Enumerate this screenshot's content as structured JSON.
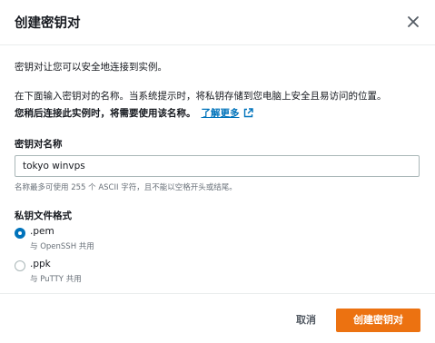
{
  "header": {
    "title": "创建密钥对",
    "close_icon": "close-icon"
  },
  "body": {
    "intro": "密钥对让您可以安全地连接到实例。",
    "instruction": "在下面输入密钥对的名称。当系统提示时，将私钥存储到您电脑上安全且易访问的位置。",
    "instruction_bold": "您稍后连接此实例时，将需要使用该名称。",
    "learn_more": "了解更多",
    "external_icon": "external-link-icon"
  },
  "name_field": {
    "label": "密钥对名称",
    "value": "tokyo winvps",
    "hint": "名称最多可使用 255 个 ASCII 字符，且不能以空格开头或结尾。"
  },
  "format": {
    "label": "私钥文件格式",
    "options": [
      {
        "label": ".pem",
        "desc": "与 OpenSSH 共用",
        "selected": true
      },
      {
        "label": ".ppk",
        "desc": "与 PuTTY 共用",
        "selected": false
      }
    ]
  },
  "footer": {
    "cancel_label": "取消",
    "create_label": "创建密钥对"
  },
  "colors": {
    "primary": "#ec7211",
    "link": "#0073bb",
    "radio_selected": "#0073bb"
  }
}
